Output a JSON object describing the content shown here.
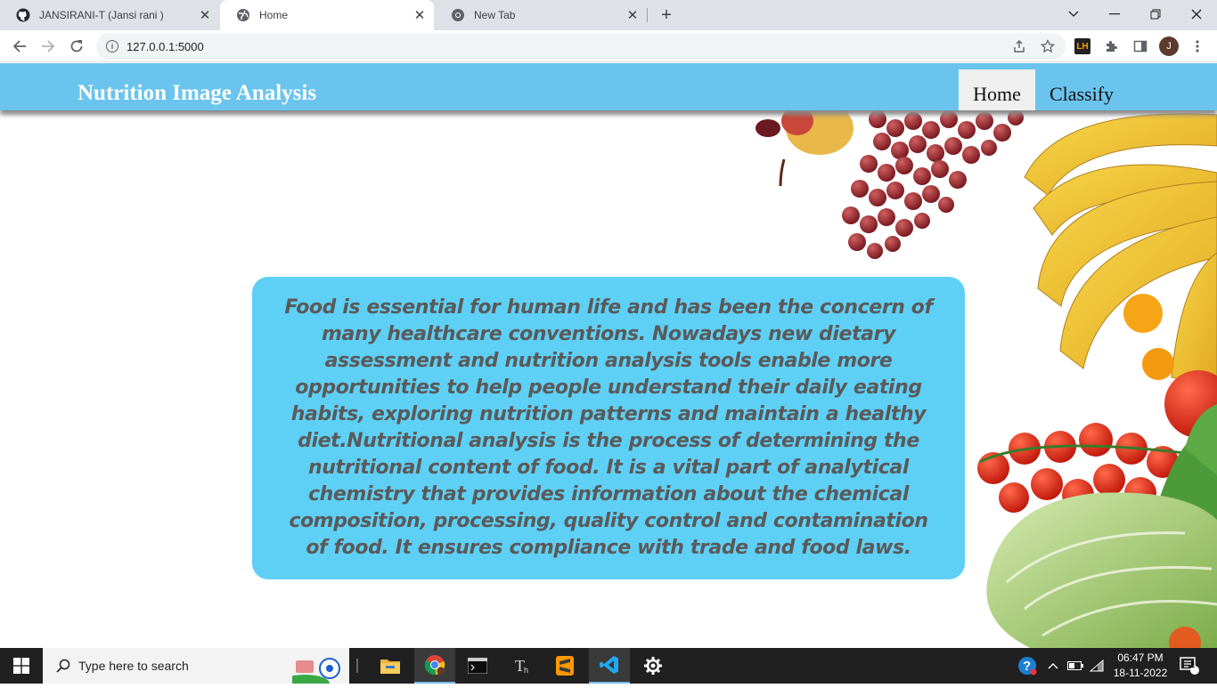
{
  "browser": {
    "tabs": [
      {
        "title": "JANSIRANI-T (Jansi rani )",
        "icon": "github-icon"
      },
      {
        "title": "Home",
        "icon": "globe-icon"
      },
      {
        "title": "New Tab",
        "icon": "chrome-icon"
      }
    ],
    "url": "127.0.0.1:5000",
    "profile_initial": "J",
    "extension_label": "LH"
  },
  "page": {
    "brand": "Nutrition Image Analysis",
    "nav": [
      {
        "label": "Home",
        "active": true
      },
      {
        "label": "Classify",
        "active": false
      }
    ],
    "description": "Food is essential for human life and has been the concern of many healthcare conventions. Nowadays new dietary assessment and nutrition analysis tools enable more opportunities to help people understand their daily eating habits, exploring nutrition patterns and maintain a healthy diet.Nutritional analysis is the process of determining the nutritional content of food. It is a vital part of analytical chemistry that provides information about the chemical composition, processing, quality control and contamination of food. It ensures compliance with trade and food laws.",
    "colors": {
      "navbar": "#6ac4ee",
      "card": "#5fd0f5",
      "text": "#5a5a5a"
    }
  },
  "taskbar": {
    "search_placeholder": "Type here to search",
    "time": "06:47 PM",
    "date": "18-11-2022",
    "notification_count": "1"
  }
}
